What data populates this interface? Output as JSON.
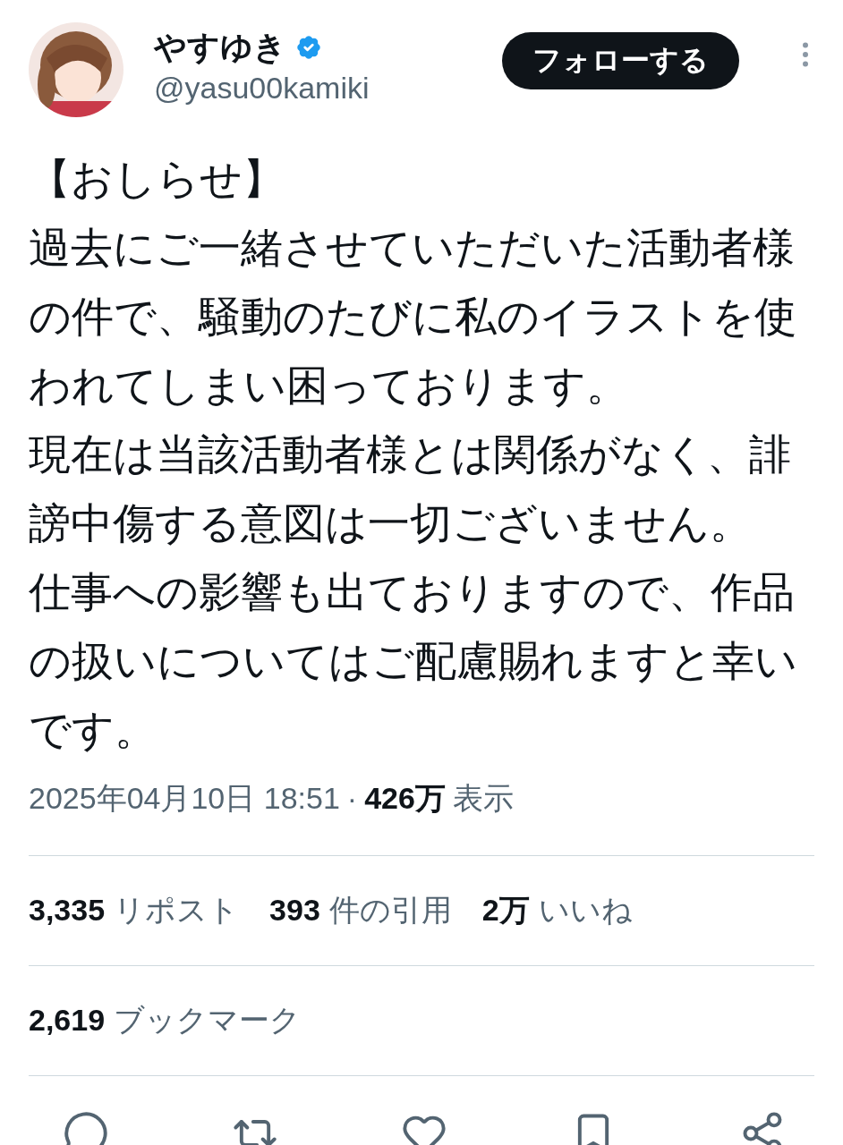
{
  "author": {
    "name": "やすゆき",
    "verified": true,
    "handle": "@yasu00kamiki"
  },
  "follow_button": "フォローする",
  "post": {
    "paragraphs": [
      "【おしらせ】",
      "過去にご一緒させていただいた活動者様の件で、騒動のたびに私のイラストを使われてしまい困っております。",
      "現在は当該活動者様とは関係がなく、誹謗中傷する意図は一切ございません。",
      "仕事への影響も出ておりますので、作品の扱いについてはご配慮賜れますと幸いです。"
    ]
  },
  "meta": {
    "timestamp": "2025年04月10日 18:51",
    "separator": "·",
    "views_count": "426万",
    "views_label": "表示"
  },
  "stats": [
    {
      "count": "3,335",
      "label": "リポスト"
    },
    {
      "count": "393",
      "label": "件の引用"
    },
    {
      "count": "2万",
      "label": "いいね"
    }
  ],
  "bookmarks": {
    "count": "2,619",
    "label": "ブックマーク"
  },
  "actions": [
    {
      "kind": "reply"
    },
    {
      "kind": "repost"
    },
    {
      "kind": "like"
    },
    {
      "kind": "bookmark"
    },
    {
      "kind": "share"
    }
  ]
}
